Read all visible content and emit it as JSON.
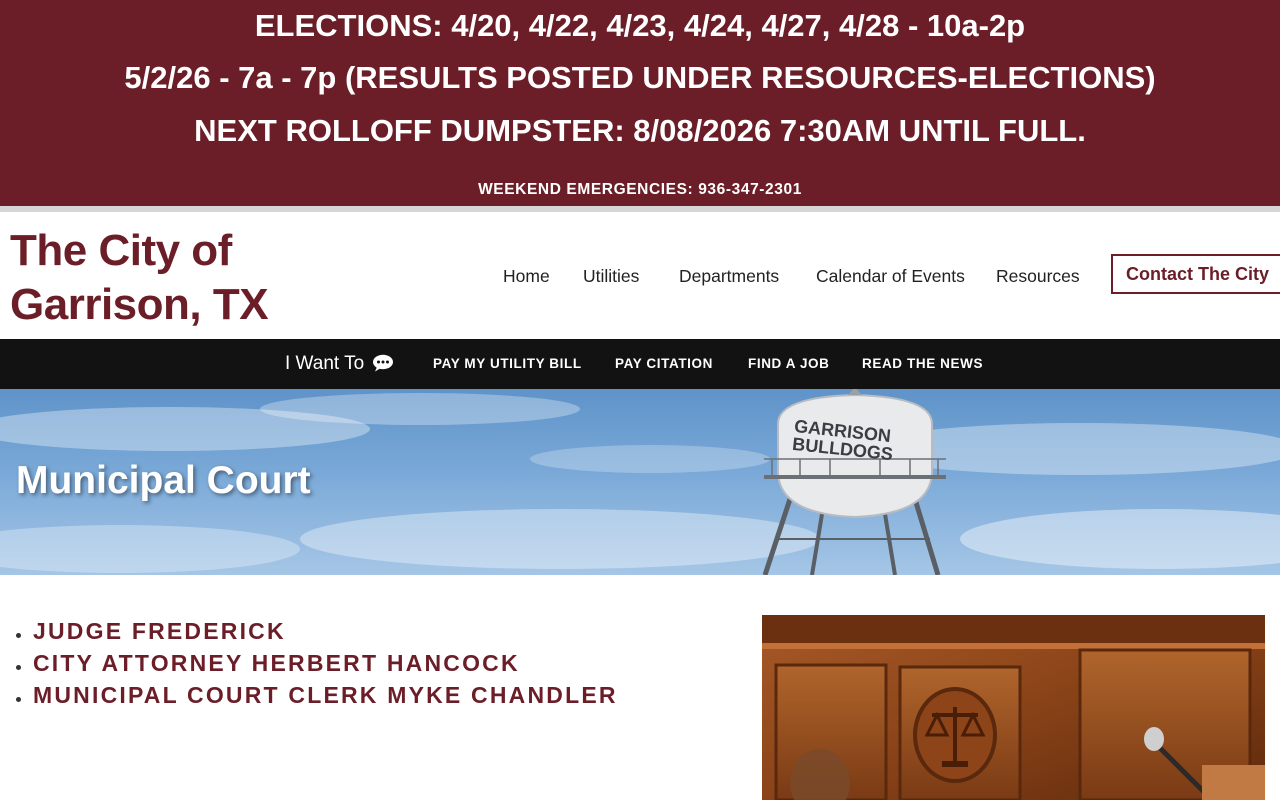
{
  "alert": {
    "line1": "ELECTIONS: 4/20, 4/22, 4/23, 4/24, 4/27, 4/28 - 10a-2p",
    "line2": "5/2/26 - 7a - 7p (RESULTS POSTED UNDER RESOURCES-ELECTIONS)",
    "line3": "NEXT ROLLOFF DUMPSTER: 8/08/2026 7:30AM UNTIL FULL.",
    "emergency": "WEEKEND EMERGENCIES: 936-347-2301"
  },
  "site": {
    "title_line1": "The City of",
    "title_line2": "Garrison, TX"
  },
  "nav": {
    "items": [
      {
        "label": "Home"
      },
      {
        "label": "Utilities"
      },
      {
        "label": "Departments"
      },
      {
        "label": "Calendar of Events"
      },
      {
        "label": "Resources"
      }
    ],
    "contact_label": "Contact The City"
  },
  "quick_links": {
    "label": "I Want To",
    "label_icon": "chat-bubble-icon",
    "items": [
      {
        "label": "PAY MY UTILITY BILL"
      },
      {
        "label": "PAY CITATION"
      },
      {
        "label": "FIND A JOB"
      },
      {
        "label": "READ THE NEWS"
      }
    ]
  },
  "hero": {
    "title": "Municipal Court",
    "tower_text_line1": "GARRISON",
    "tower_text_line2": "BULLDOGS"
  },
  "staff": [
    {
      "label": "JUDGE FREDERICK"
    },
    {
      "label": "CITY ATTORNEY HERBERT HANCOCK"
    },
    {
      "label": "MUNICIPAL COURT CLERK MYKE CHANDLER"
    }
  ],
  "colors": {
    "brand": "#6b1e28",
    "quick_bar": "#121212",
    "sky": "#7aa9d8"
  }
}
